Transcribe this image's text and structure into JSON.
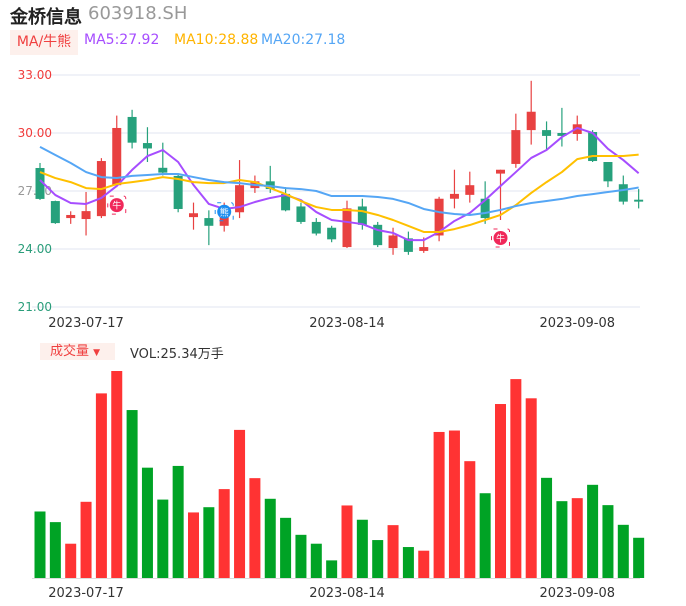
{
  "header": {
    "name": "金桥信息",
    "code": "603918.SH"
  },
  "legend": {
    "toggle": "MA/牛熊",
    "ma5": "MA5:27.92",
    "ma10": "MA10:28.88",
    "ma20": "MA20:27.18"
  },
  "volume_panel": {
    "toggle": "成交量",
    "toggle_icon": "caret-down-icon",
    "vol": "VOL:25.34万手"
  },
  "colors": {
    "up": "#e84141",
    "down": "#26a17c",
    "vol_up": "#ff3333",
    "vol_down": "#00a325",
    "ma5": "#a64dff",
    "ma10": "#ffc000",
    "ma20": "#55a6f5"
  },
  "chart_data": [
    {
      "type": "candlestick",
      "ylim": [
        21,
        33
      ],
      "yticks": [
        {
          "v": 33,
          "label": "33.00"
        },
        {
          "v": 30,
          "label": "30.00"
        },
        {
          "v": 27,
          "label": "27.00"
        },
        {
          "v": 24,
          "label": "24.00"
        },
        {
          "v": 21,
          "label": "21.00"
        }
      ],
      "date_ticks": [
        {
          "index": 3,
          "label": "2023-07-17"
        },
        {
          "index": 20,
          "label": "2023-08-14"
        },
        {
          "index": 35,
          "label": "2023-09-08"
        }
      ],
      "grid": true,
      "ohlc": [
        [
          28.19,
          28.45,
          26.54,
          26.59
        ],
        [
          26.48,
          26.5,
          25.3,
          25.34
        ],
        [
          25.6,
          25.95,
          25.3,
          25.76
        ],
        [
          25.55,
          26.95,
          24.7,
          25.96
        ],
        [
          25.7,
          28.7,
          25.6,
          28.55
        ],
        [
          27.3,
          30.9,
          27.2,
          30.26
        ],
        [
          30.83,
          31.2,
          29.2,
          29.5
        ],
        [
          29.48,
          30.3,
          28.5,
          29.2
        ],
        [
          28.2,
          29.5,
          27.8,
          27.95
        ],
        [
          27.78,
          27.9,
          25.9,
          26.07
        ],
        [
          25.65,
          26.4,
          25.0,
          25.85
        ],
        [
          25.6,
          26.0,
          24.2,
          25.2
        ],
        [
          25.2,
          26.4,
          24.9,
          26.0
        ],
        [
          25.9,
          28.6,
          25.6,
          27.3
        ],
        [
          27.15,
          27.8,
          26.9,
          27.5
        ],
        [
          27.5,
          28.3,
          26.9,
          27.1
        ],
        [
          26.85,
          27.2,
          25.95,
          26.0
        ],
        [
          26.2,
          26.4,
          25.3,
          25.4
        ],
        [
          25.4,
          25.6,
          24.7,
          24.8
        ],
        [
          25.1,
          25.2,
          24.35,
          24.5
        ],
        [
          24.1,
          26.5,
          24.05,
          26.1
        ],
        [
          26.2,
          26.6,
          25.0,
          25.25
        ],
        [
          25.25,
          25.4,
          24.1,
          24.2
        ],
        [
          24.05,
          25.1,
          23.7,
          24.7
        ],
        [
          24.55,
          24.9,
          23.7,
          23.85
        ],
        [
          23.9,
          24.6,
          23.8,
          24.1
        ],
        [
          24.7,
          26.7,
          24.4,
          26.6
        ],
        [
          26.6,
          28.1,
          26.1,
          26.85
        ],
        [
          26.8,
          28.0,
          26.4,
          27.3
        ],
        [
          26.6,
          27.5,
          25.3,
          25.6
        ],
        [
          27.9,
          28.1,
          25.5,
          28.1
        ],
        [
          28.4,
          31.0,
          28.2,
          30.15
        ],
        [
          30.15,
          32.7,
          29.4,
          31.1
        ],
        [
          30.15,
          30.6,
          29.1,
          29.85
        ],
        [
          30.0,
          31.3,
          29.3,
          29.85
        ],
        [
          29.95,
          30.9,
          29.6,
          30.45
        ],
        [
          30.05,
          30.15,
          28.5,
          28.55
        ],
        [
          28.5,
          28.5,
          27.2,
          27.5
        ],
        [
          27.35,
          27.8,
          26.3,
          26.45
        ],
        [
          26.55,
          27.1,
          26.1,
          26.45
        ]
      ],
      "series": [
        {
          "name": "MA5",
          "values": [
            27.57,
            26.79,
            26.38,
            26.33,
            26.64,
            27.26,
            28.09,
            28.81,
            29.12,
            28.5,
            27.31,
            26.33,
            26.07,
            26.17,
            26.43,
            26.64,
            26.79,
            26.53,
            25.91,
            25.5,
            25.4,
            25.29,
            24.98,
            24.83,
            24.46,
            24.46,
            24.88,
            25.45,
            25.86,
            26.53,
            27.26,
            27.98,
            28.71,
            29.12,
            29.79,
            30.26,
            30.0,
            29.18,
            28.6,
            27.92
          ]
        },
        {
          "name": "MA10",
          "values": [
            27.98,
            27.67,
            27.46,
            27.15,
            27.1,
            27.36,
            27.46,
            27.57,
            27.72,
            27.62,
            27.46,
            27.41,
            27.41,
            27.57,
            27.46,
            27.15,
            26.84,
            26.48,
            26.17,
            26.02,
            26.02,
            25.96,
            25.76,
            25.5,
            25.19,
            24.88,
            24.88,
            25.03,
            25.24,
            25.5,
            25.76,
            26.27,
            26.9,
            27.46,
            27.98,
            28.65,
            28.81,
            28.81,
            28.81,
            28.88
          ]
        },
        {
          "name": "MA20",
          "values": [
            29.28,
            28.86,
            28.45,
            27.98,
            27.72,
            27.67,
            27.78,
            27.83,
            27.88,
            27.88,
            27.72,
            27.57,
            27.46,
            27.41,
            27.31,
            27.26,
            27.15,
            27.1,
            27.0,
            26.74,
            26.74,
            26.74,
            26.69,
            26.59,
            26.38,
            26.07,
            25.91,
            25.81,
            25.76,
            25.86,
            26.02,
            26.22,
            26.38,
            26.48,
            26.59,
            26.74,
            26.84,
            26.95,
            27.05,
            27.18
          ]
        }
      ],
      "signals": [
        {
          "index": 5,
          "label": "牛",
          "type": "bull"
        },
        {
          "index": 12,
          "label": "熊",
          "type": "bear"
        },
        {
          "index": 30,
          "label": "牛",
          "type": "bull"
        }
      ]
    },
    {
      "type": "bar",
      "unit": "万手",
      "values": [
        41.9,
        35.2,
        21.6,
        48.0,
        116.3,
        130.4,
        105.8,
        69.5,
        49.4,
        70.6,
        41.3,
        44.6,
        56.0,
        93.3,
        62.9,
        49.9,
        37.9,
        27.2,
        21.6,
        11.1,
        45.7,
        36.7,
        23.9,
        33.3,
        19.5,
        17.2,
        92.0,
        92.9,
        73.6,
        53.4,
        109.6,
        125.3,
        113.2,
        63.1,
        48.4,
        50.3,
        58.7,
        45.9,
        33.5,
        25.34
      ],
      "date_ticks": [
        {
          "index": 3,
          "label": "2023-07-17"
        },
        {
          "index": 20,
          "label": "2023-08-14"
        },
        {
          "index": 35,
          "label": "2023-09-08"
        }
      ]
    }
  ]
}
